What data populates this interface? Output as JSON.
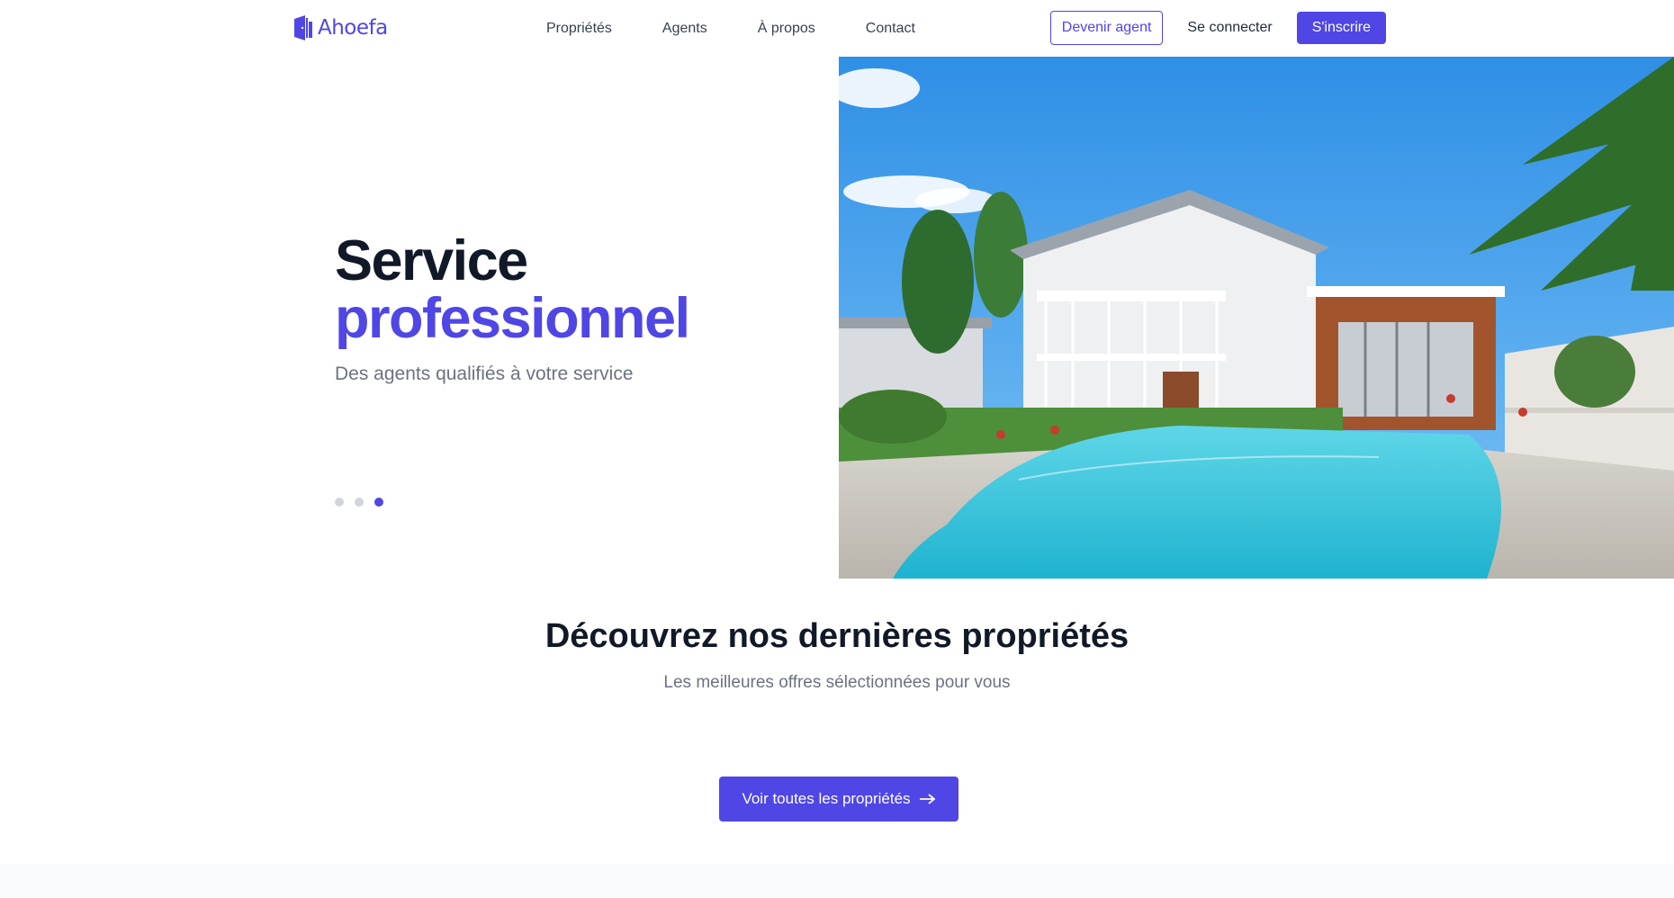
{
  "brand": {
    "name": "Ahoefa",
    "accent": "#4f46e5"
  },
  "nav": {
    "links": [
      "Propriétés",
      "Agents",
      "À propos",
      "Contact"
    ],
    "become_agent": "Devenir agent",
    "login": "Se connecter",
    "signup": "S'inscrire"
  },
  "hero": {
    "title_line1": "Service",
    "title_line2": "professionnel",
    "subtitle": "Des agents qualifiés à votre service",
    "slides_total": 3,
    "active_slide": 3,
    "image": "house-with-pool-photo"
  },
  "section": {
    "title": "Découvrez nos dernières propriétés",
    "subtitle": "Les meilleures offres sélectionnées pour vous",
    "cta_label": "Voir toutes les propriétés",
    "cta_icon": "arrow-right-icon"
  }
}
